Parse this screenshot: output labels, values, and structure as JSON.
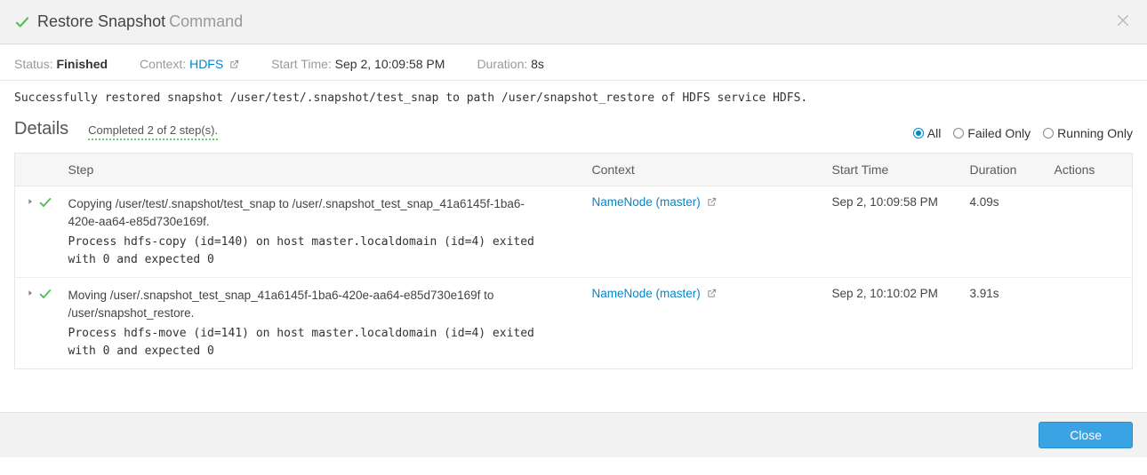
{
  "header": {
    "title": "Restore Snapshot",
    "subtitle": "Command"
  },
  "meta": {
    "status_label": "Status:",
    "status_value": "Finished",
    "context_label": "Context:",
    "context_value": "HDFS",
    "start_label": "Start Time:",
    "start_value": "Sep 2, 10:09:58 PM",
    "duration_label": "Duration:",
    "duration_value": "8s"
  },
  "message": "Successfully restored snapshot /user/test/.snapshot/test_snap to path /user/snapshot_restore of HDFS service HDFS.",
  "details": {
    "heading": "Details",
    "completed": "Completed 2 of 2 step(s)."
  },
  "filters": {
    "all": "All",
    "failed": "Failed Only",
    "running": "Running Only"
  },
  "columns": {
    "step": "Step",
    "context": "Context",
    "start": "Start Time",
    "duration": "Duration",
    "actions": "Actions"
  },
  "rows": [
    {
      "title": "Copying /user/test/.snapshot/test_snap to /user/.snapshot_test_snap_41a6145f-1ba6-420e-aa64-e85d730e169f.",
      "detail": "Process hdfs-copy (id=140) on host master.localdomain (id=4) exited with 0 and expected 0",
      "context": "NameNode (master)",
      "start": "Sep 2, 10:09:58 PM",
      "duration": "4.09s"
    },
    {
      "title": "Moving /user/.snapshot_test_snap_41a6145f-1ba6-420e-aa64-e85d730e169f to /user/snapshot_restore.",
      "detail": "Process hdfs-move (id=141) on host master.localdomain (id=4) exited with 0 and expected 0",
      "context": "NameNode (master)",
      "start": "Sep 2, 10:10:02 PM",
      "duration": "3.91s"
    }
  ],
  "footer": {
    "close": "Close"
  }
}
